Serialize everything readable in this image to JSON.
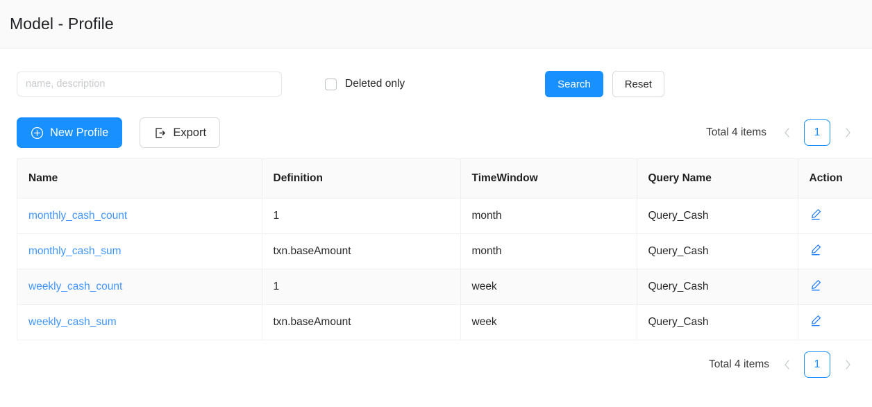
{
  "header": {
    "title": "Model - Profile"
  },
  "filter": {
    "search_placeholder": "name, description",
    "search_value": "",
    "deleted_only_label": "Deleted only",
    "deleted_only_checked": false,
    "search_button": "Search",
    "reset_button": "Reset"
  },
  "toolbar": {
    "new_profile_label": "New Profile",
    "new_profile_icon": "plus-circle-icon",
    "export_label": "Export",
    "export_icon": "export-icon"
  },
  "pagination": {
    "total_text": "Total 4 items",
    "prev_icon": "chevron-left-icon",
    "next_icon": "chevron-right-icon",
    "current_page": "1"
  },
  "table": {
    "columns": [
      {
        "key": "name",
        "label": "Name"
      },
      {
        "key": "definition",
        "label": "Definition"
      },
      {
        "key": "timewindow",
        "label": "TimeWindow"
      },
      {
        "key": "query_name",
        "label": "Query Name"
      },
      {
        "key": "action",
        "label": "Action"
      }
    ],
    "rows": [
      {
        "name": "monthly_cash_count",
        "definition": "1",
        "timewindow": "month",
        "query_name": "Query_Cash",
        "action_icon": "edit-icon",
        "hovered": false
      },
      {
        "name": "monthly_cash_sum",
        "definition": "txn.baseAmount",
        "timewindow": "month",
        "query_name": "Query_Cash",
        "action_icon": "edit-icon",
        "hovered": false
      },
      {
        "name": "weekly_cash_count",
        "definition": "1",
        "timewindow": "week",
        "query_name": "Query_Cash",
        "action_icon": "edit-icon",
        "hovered": true
      },
      {
        "name": "weekly_cash_sum",
        "definition": "txn.baseAmount",
        "timewindow": "week",
        "query_name": "Query_Cash",
        "action_icon": "edit-icon",
        "hovered": false
      }
    ]
  },
  "colors": {
    "primary": "#1890ff",
    "link": "#4096ff",
    "header_band": "#fafafa",
    "border": "#f0f0f0"
  }
}
